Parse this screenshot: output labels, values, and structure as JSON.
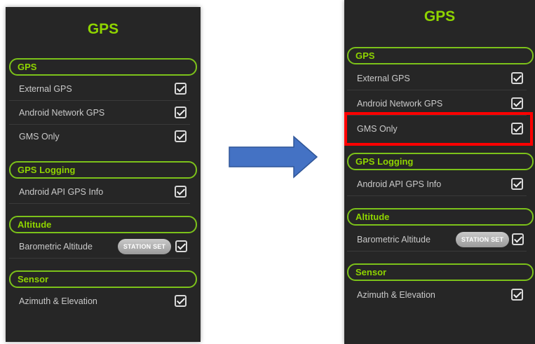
{
  "colors": {
    "accent": "#8fd400",
    "background": "#262626",
    "highlight": "#ff0000",
    "arrow": "#4472c4"
  },
  "screens": [
    {
      "title": "GPS",
      "sections": [
        {
          "header": "GPS",
          "rows": [
            {
              "label": "External GPS",
              "checked": true
            },
            {
              "label": "Android Network GPS",
              "checked": true
            },
            {
              "label": "GMS Only",
              "checked": true
            }
          ]
        },
        {
          "header": "GPS Logging",
          "rows": [
            {
              "label": "Android API GPS Info",
              "checked": true
            }
          ]
        },
        {
          "header": "Altitude",
          "rows": [
            {
              "label": "Barometric Altitude",
              "checked": true,
              "button": "STATION SET"
            }
          ]
        },
        {
          "header": "Sensor",
          "rows": [
            {
              "label": "Azimuth & Elevation",
              "checked": true
            }
          ]
        }
      ]
    },
    {
      "title": "GPS",
      "sections": [
        {
          "header": "GPS",
          "rows": [
            {
              "label": "External GPS",
              "checked": true
            },
            {
              "label": "Android Network GPS",
              "checked": true
            },
            {
              "label": "GMS Only",
              "checked": true,
              "highlighted": true
            }
          ]
        },
        {
          "header": "GPS Logging",
          "rows": [
            {
              "label": "Android API GPS Info",
              "checked": true
            }
          ]
        },
        {
          "header": "Altitude",
          "rows": [
            {
              "label": "Barometric Altitude",
              "checked": true,
              "button": "STATION SET"
            }
          ]
        },
        {
          "header": "Sensor",
          "rows": [
            {
              "label": "Azimuth & Elevation",
              "checked": true
            }
          ]
        }
      ]
    }
  ]
}
